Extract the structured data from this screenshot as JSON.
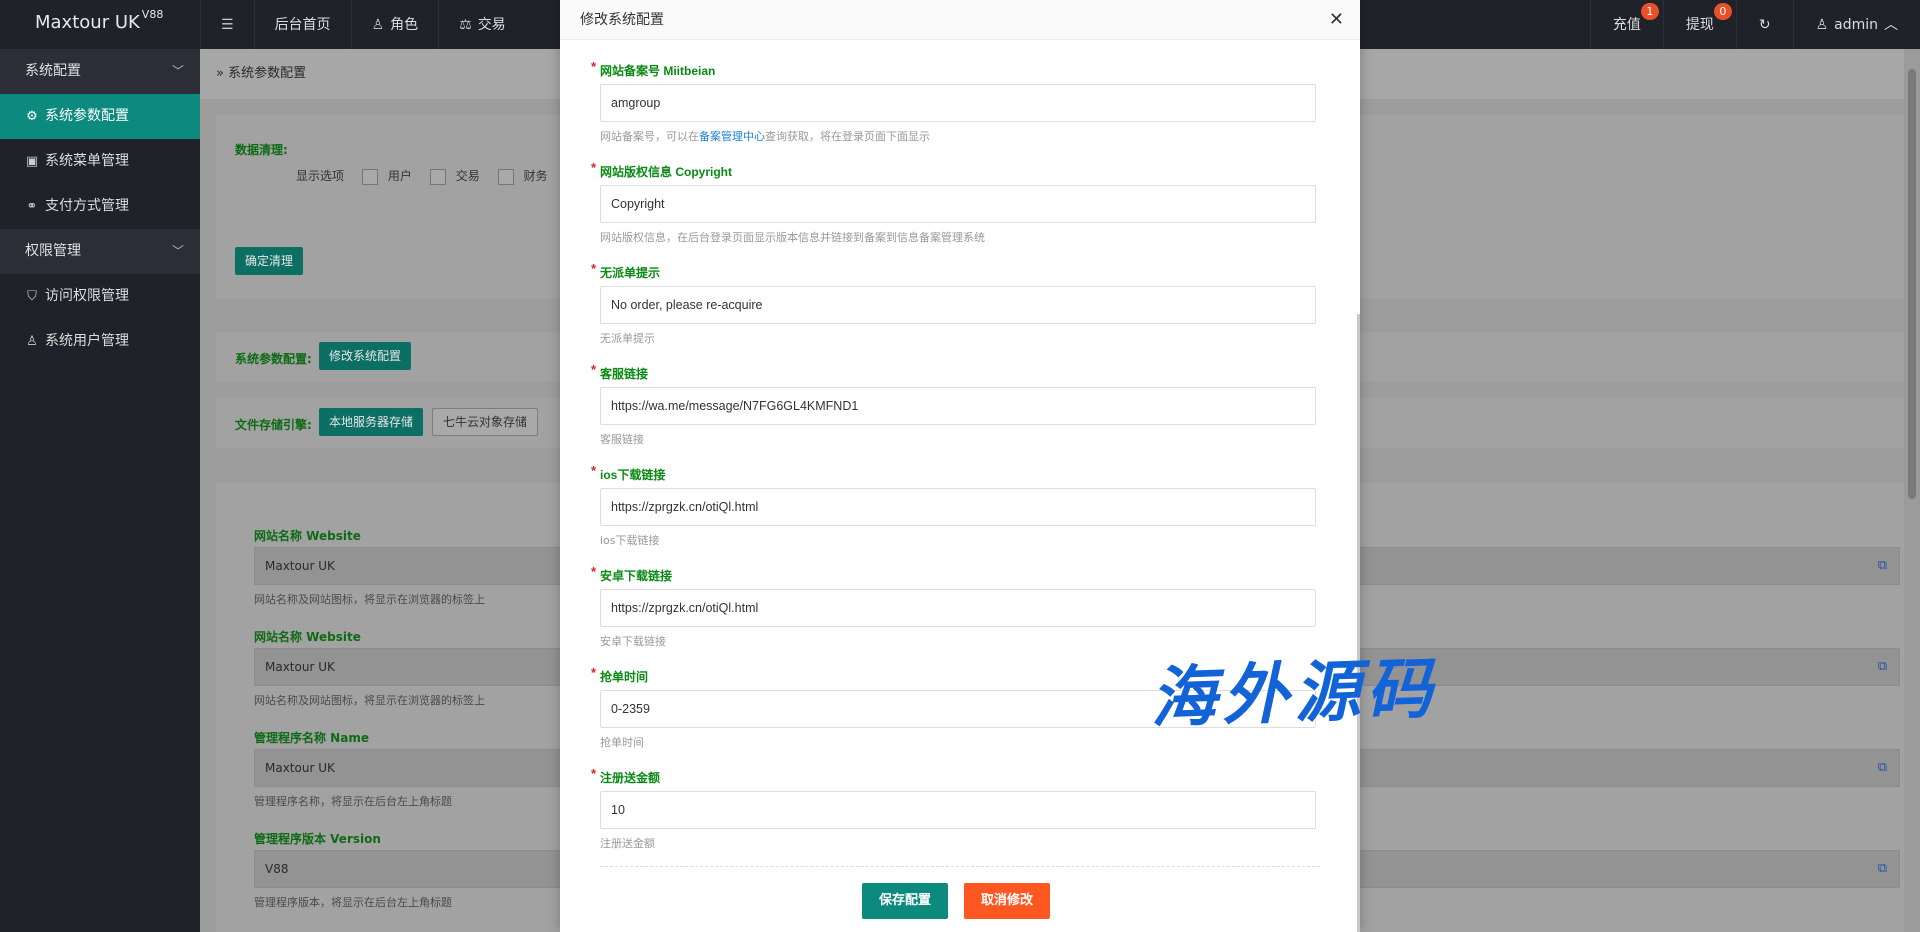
{
  "app": {
    "logo": "Maxtour UK",
    "version": "V88"
  },
  "topnav": [
    {
      "icon": "menu-icon",
      "label": ""
    },
    {
      "icon": "",
      "label": "后台首页"
    },
    {
      "icon": "user-icon",
      "label": "角色"
    },
    {
      "icon": "scale-icon",
      "label": "交易"
    }
  ],
  "topright": {
    "recharge": {
      "label": "充值",
      "badge": "1"
    },
    "withdraw": {
      "label": "提现",
      "badge": "0"
    },
    "user": {
      "label": "admin"
    }
  },
  "sidebar": {
    "groups": [
      {
        "label": "系统配置",
        "items": [
          {
            "label": "系统参数配置",
            "icon": "gear-icon"
          },
          {
            "label": "系统菜单管理",
            "icon": "window-icon"
          },
          {
            "label": "支付方式管理",
            "icon": "link-icon"
          }
        ]
      },
      {
        "label": "权限管理",
        "items": [
          {
            "label": "访问权限管理",
            "icon": "shield-icon"
          },
          {
            "label": "系统用户管理",
            "icon": "user-icon"
          }
        ]
      }
    ]
  },
  "breadcrumb": "系统参数配置",
  "cleanup": {
    "title": "数据清理:",
    "display_label": "显示选项",
    "options": [
      "用户",
      "交易",
      "财务"
    ],
    "button": "确定清理"
  },
  "sysconfig": {
    "title": "系统参数配置:",
    "button": "修改系统配置"
  },
  "storage": {
    "title": "文件存储引擎:",
    "buttons": [
      "本地服务器存储",
      "七牛云对象存储"
    ]
  },
  "bg_fields": [
    {
      "label": "网站名称 Website",
      "value": "Maxtour UK",
      "help": "网站名称及网站图标，将显示在浏览器的标签上"
    },
    {
      "label": "网站名称 Website",
      "value": "Maxtour UK",
      "help": "网站名称及网站图标，将显示在浏览器的标签上"
    },
    {
      "label": "管理程序名称 Name",
      "value": "Maxtour UK",
      "help": "管理程序名称，将显示在后台左上角标题"
    },
    {
      "label": "管理程序版本 Version",
      "value": "V88",
      "help": "管理程序版本，将显示在后台左上角标题"
    }
  ],
  "modal": {
    "title": "修改系统配置",
    "fields": [
      {
        "label": "网站备案号 Miitbeian",
        "value": "amgroup",
        "help_pre": "网站备案号，可以在",
        "help_link": "备案管理中心",
        "help_post": "查询获取，将在登录页面下面显示"
      },
      {
        "label": "网站版权信息 Copyright",
        "value": "Copyright",
        "help": "网站版权信息，在后台登录页面显示版本信息并链接到备案到信息备案管理系统"
      },
      {
        "label": "无派单提示",
        "value": "No order, please re-acquire",
        "help": "无派单提示"
      },
      {
        "label": "客服链接",
        "value": "https://wa.me/message/N7FG6GL4KMFND1",
        "help": "客服链接"
      },
      {
        "label": "ios下载链接",
        "value": "https://zprgzk.cn/otiQl.html",
        "help": "ios下载链接"
      },
      {
        "label": "安卓下载链接",
        "value": "https://zprgzk.cn/otiQl.html",
        "help": "安卓下载链接"
      },
      {
        "label": "抢单时间",
        "value": "0-2359",
        "help": "抢单时间"
      },
      {
        "label": "注册送金额",
        "value": "10",
        "help": "注册送金额"
      }
    ],
    "save": "保存配置",
    "cancel": "取消修改"
  },
  "watermark": "海外源码",
  "colors": {
    "accent": "#0c8a7d",
    "danger": "#ff5722",
    "label_green": "#0a8a14",
    "sidebar_bg": "#20222a"
  }
}
